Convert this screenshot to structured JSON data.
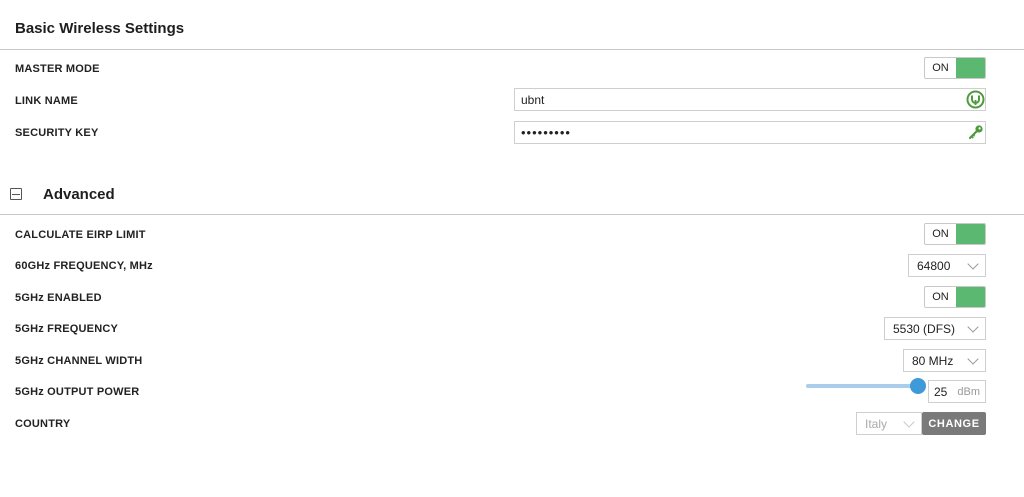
{
  "basic": {
    "title": "Basic Wireless Settings",
    "master_mode": {
      "label": "MASTER MODE",
      "toggle": "ON",
      "state": true
    },
    "link_name": {
      "label": "LINK NAME",
      "value": "ubnt"
    },
    "security_key": {
      "label": "SECURITY KEY",
      "value": "•••••••••"
    }
  },
  "advanced": {
    "title": "Advanced",
    "collapse_icon": "minus-square-icon",
    "calculate_eirp": {
      "label": "CALCULATE EIRP LIMIT",
      "toggle": "ON",
      "state": true
    },
    "freq_60": {
      "label": "60GHz FREQUENCY, MHz",
      "value": "64800"
    },
    "enabled_5": {
      "label": "5GHz ENABLED",
      "toggle": "ON",
      "state": true
    },
    "freq_5": {
      "label": "5GHz FREQUENCY",
      "value": "5530 (DFS)"
    },
    "width_5": {
      "label": "5GHz CHANNEL WIDTH",
      "value": "80 MHz"
    },
    "power_5": {
      "label": "5GHz OUTPUT POWER",
      "value": "25",
      "unit": "dBm",
      "level": 1.0
    },
    "country": {
      "label": "COUNTRY",
      "value": "Italy",
      "button": "CHANGE"
    }
  },
  "colors": {
    "toggle_on": "#5ab870",
    "slider": "#3f9ad9",
    "button": "#7a7a7a",
    "icon_green": "#4e9a3e"
  }
}
